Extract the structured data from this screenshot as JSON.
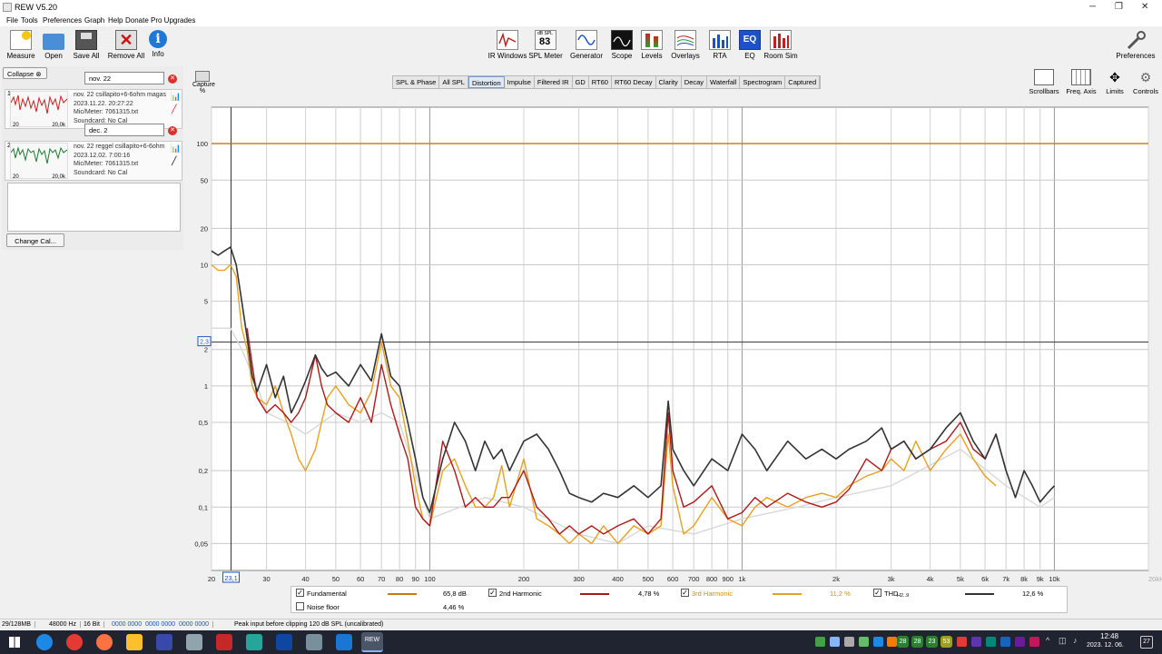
{
  "app": {
    "title": "REW V5.20"
  },
  "window_controls": {
    "minimize": "─",
    "maximize": "❐",
    "close": "✕"
  },
  "menu": [
    "File",
    "Tools",
    "Preferences",
    "Graph",
    "Help",
    "Donate",
    "Pro Upgrades"
  ],
  "toolbar_left": [
    {
      "label": "Measure",
      "icon": "microphone-icon"
    },
    {
      "label": "Open",
      "icon": "folder-icon"
    },
    {
      "label": "Save All",
      "icon": "save-icon"
    },
    {
      "label": "Remove All",
      "icon": "remove-icon"
    },
    {
      "label": "Info",
      "icon": "info-icon"
    }
  ],
  "toolbar_center": [
    {
      "label": "IR Windows",
      "icon": "ir-windows-icon"
    },
    {
      "label": "SPL Meter",
      "icon": "spl-meter-icon",
      "badge_top": "dB SPL",
      "badge_value": "83"
    },
    {
      "label": "Generator",
      "icon": "generator-icon"
    },
    {
      "label": "Scope",
      "icon": "scope-icon"
    },
    {
      "label": "Levels",
      "icon": "levels-icon"
    },
    {
      "label": "Overlays",
      "icon": "overlays-icon"
    },
    {
      "label": "RTA",
      "icon": "rta-icon"
    },
    {
      "label": "EQ",
      "icon": "eq-icon"
    },
    {
      "label": "Room Sim",
      "icon": "room-sim-icon"
    }
  ],
  "toolbar_right": {
    "label": "Preferences",
    "icon": "wrench-icon"
  },
  "capture": {
    "label": "Capture",
    "unit": "%"
  },
  "tabs": [
    "SPL & Phase",
    "All SPL",
    "Distortion",
    "Impulse",
    "Filtered IR",
    "GD",
    "RT60",
    "RT60 Decay",
    "Clarity",
    "Decay",
    "Waterfall",
    "Spectrogram",
    "Captured"
  ],
  "selected_tab": "Distortion",
  "graph_controls": [
    "Scrollbars",
    "Freq. Axis",
    "Limits",
    "Controls"
  ],
  "left_panel": {
    "collapse_label": "Collapse",
    "change_cal_label": "Change Cal...",
    "measurements": [
      {
        "index": "1",
        "name": "nov. 22",
        "title": "nov. 22 csillapito+6-6ohm magas",
        "date": "2023.11.22. 20:27:22",
        "mic": "Mic/Meter: 7061315.txt",
        "soundcard": "Soundcard: No Cal",
        "thumb_left": "20",
        "thumb_right": "20,0k",
        "color": "#c81e1e"
      },
      {
        "index": "2",
        "name": "dec. 2",
        "title": "nov. 22 reggel csillapito+6-6ohm",
        "date": "2023.12.02. 7:00:16",
        "mic": "Mic/Meter: 7061315.txt",
        "soundcard": "Soundcard: No Cal",
        "thumb_left": "20",
        "thumb_right": "20,0k",
        "color": "#1e7a2e"
      }
    ]
  },
  "chart_data": {
    "type": "line",
    "xscale": "log",
    "yscale": "log",
    "xlim": [
      20,
      20000
    ],
    "ylim": [
      0.03,
      200
    ],
    "y_ticks": [
      "100",
      "50",
      "20",
      "10",
      "5",
      "2",
      "1",
      "0,5",
      "0,2",
      "0,1",
      "0,05"
    ],
    "y_tick_values": [
      100,
      50,
      20,
      10,
      5,
      2,
      1,
      0.5,
      0.2,
      0.1,
      0.05
    ],
    "x_ticks": [
      "20",
      "30",
      "40",
      "50",
      "60",
      "70",
      "80",
      "90",
      "100",
      "200",
      "300",
      "400",
      "500",
      "600",
      "700",
      "800",
      "900",
      "1k",
      "2k",
      "3k",
      "4k",
      "5k",
      "6k",
      "7k",
      "8k",
      "9k",
      "10k",
      "20kHz"
    ],
    "x_tick_values": [
      20,
      30,
      40,
      50,
      60,
      70,
      80,
      90,
      100,
      200,
      300,
      400,
      500,
      600,
      700,
      800,
      900,
      1000,
      2000,
      3000,
      4000,
      5000,
      6000,
      7000,
      8000,
      9000,
      10000,
      20000
    ],
    "x_ticks_faded": [
      "10k",
      "20kHz"
    ],
    "cursor_x_label": "23,1",
    "cursor_x": 23.1,
    "cursor_y_label": "2,3",
    "cursor_y": 2.3,
    "hline_100": 100,
    "series": [
      {
        "name": "THD",
        "color": "#333333",
        "x": [
          20,
          21,
          22,
          23,
          24,
          25,
          26,
          27,
          28,
          30,
          32,
          34,
          36,
          38,
          40,
          43,
          45,
          47,
          50,
          55,
          60,
          65,
          70,
          75,
          80,
          85,
          90,
          95,
          100,
          110,
          120,
          130,
          140,
          150,
          160,
          170,
          180,
          200,
          220,
          240,
          260,
          280,
          300,
          330,
          360,
          400,
          450,
          500,
          550,
          580,
          600,
          650,
          700,
          800,
          900,
          1000,
          1100,
          1200,
          1400,
          1600,
          1800,
          2000,
          2200,
          2500,
          2800,
          3000,
          3300,
          3600,
          4000,
          4500,
          5000,
          5500,
          6000,
          6500,
          7000,
          7500,
          8000,
          8500,
          9000,
          9500,
          10000
        ],
        "y": [
          13,
          12,
          13,
          14,
          10,
          5,
          2.5,
          1.2,
          0.9,
          1.5,
          0.8,
          1.2,
          0.6,
          0.8,
          1.1,
          1.8,
          1.4,
          1.2,
          1.3,
          1.0,
          1.5,
          1.1,
          2.7,
          1.2,
          1.0,
          0.5,
          0.25,
          0.12,
          0.09,
          0.25,
          0.5,
          0.35,
          0.2,
          0.35,
          0.25,
          0.3,
          0.2,
          0.35,
          0.4,
          0.3,
          0.2,
          0.13,
          0.12,
          0.11,
          0.13,
          0.12,
          0.15,
          0.12,
          0.15,
          0.75,
          0.3,
          0.2,
          0.15,
          0.25,
          0.2,
          0.4,
          0.3,
          0.2,
          0.35,
          0.25,
          0.3,
          0.25,
          0.3,
          0.35,
          0.45,
          0.3,
          0.35,
          0.25,
          0.3,
          0.45,
          0.6,
          0.35,
          0.25,
          0.4,
          0.2,
          0.12,
          0.2,
          0.15,
          0.11,
          0.13,
          0.15
        ]
      },
      {
        "name": "Fundamental",
        "color": "#c87814",
        "x": [
          20,
          20000
        ],
        "y": [
          100,
          100
        ]
      },
      {
        "name": "2nd Harmonic",
        "color": "#b01818",
        "x": [
          26,
          27,
          28,
          30,
          32,
          34,
          36,
          38,
          40,
          43,
          45,
          47,
          50,
          55,
          60,
          65,
          70,
          75,
          80,
          85,
          90,
          95,
          100,
          110,
          120,
          130,
          140,
          150,
          160,
          170,
          180,
          200,
          220,
          240,
          260,
          280,
          300,
          330,
          360,
          400,
          450,
          500,
          550,
          580,
          600,
          650,
          700,
          800,
          900,
          1000,
          1100,
          1200,
          1400,
          1600,
          1800,
          2000,
          2200,
          2500,
          2800,
          3000,
          3300,
          3600,
          4000,
          4500,
          5000,
          5500,
          6000,
          6500,
          7000
        ],
        "y": [
          3,
          1.5,
          0.8,
          0.6,
          0.7,
          0.6,
          0.5,
          0.6,
          0.8,
          1.8,
          1.0,
          0.7,
          0.6,
          0.5,
          0.8,
          0.5,
          1.5,
          0.7,
          0.4,
          0.25,
          0.1,
          0.08,
          0.07,
          0.35,
          0.2,
          0.1,
          0.12,
          0.1,
          0.1,
          0.12,
          0.12,
          0.2,
          0.1,
          0.08,
          0.06,
          0.07,
          0.06,
          0.07,
          0.06,
          0.07,
          0.08,
          0.06,
          0.08,
          0.6,
          0.2,
          0.1,
          0.11,
          0.15,
          0.08,
          0.09,
          0.12,
          0.1,
          0.13,
          0.11,
          0.1,
          0.11,
          0.14,
          0.25,
          0.2,
          0.3,
          0.35,
          0.25,
          0.3,
          0.35,
          0.5,
          0.3,
          0.25,
          0.4,
          0.2
        ]
      },
      {
        "name": "3rd Harmonic",
        "color": "#e8a020",
        "x": [
          20,
          21,
          22,
          23,
          24,
          25,
          26,
          27,
          28,
          30,
          32,
          34,
          36,
          38,
          40,
          43,
          45,
          47,
          50,
          55,
          60,
          65,
          70,
          75,
          80,
          85,
          90,
          95,
          100,
          110,
          120,
          130,
          140,
          150,
          160,
          170,
          180,
          200,
          220,
          240,
          260,
          280,
          300,
          330,
          360,
          400,
          450,
          500,
          550,
          580,
          600,
          650,
          700,
          800,
          900,
          1000,
          1100,
          1200,
          1400,
          1600,
          1800,
          2000,
          2200,
          2500,
          2800,
          3000,
          3300,
          3600,
          4000,
          4500,
          5000,
          5500,
          6000,
          6500
        ],
        "y": [
          10,
          9,
          9,
          10,
          8,
          3,
          2,
          1,
          0.8,
          0.7,
          1.0,
          0.6,
          0.4,
          0.25,
          0.2,
          0.3,
          0.5,
          0.8,
          1.0,
          0.7,
          0.6,
          0.9,
          2.3,
          1.0,
          0.8,
          0.35,
          0.15,
          0.08,
          0.07,
          0.2,
          0.25,
          0.15,
          0.1,
          0.1,
          0.12,
          0.22,
          0.1,
          0.25,
          0.08,
          0.07,
          0.06,
          0.05,
          0.06,
          0.05,
          0.07,
          0.05,
          0.07,
          0.06,
          0.07,
          0.4,
          0.15,
          0.06,
          0.07,
          0.12,
          0.08,
          0.07,
          0.1,
          0.12,
          0.1,
          0.12,
          0.13,
          0.12,
          0.15,
          0.18,
          0.2,
          0.25,
          0.2,
          0.35,
          0.2,
          0.3,
          0.4,
          0.25,
          0.18,
          0.15
        ]
      },
      {
        "name": "Noise floor",
        "color": "#d8d8d8",
        "x": [
          20,
          23,
          25,
          28,
          30,
          35,
          40,
          50,
          60,
          70,
          80,
          100,
          150,
          200,
          300,
          400,
          500,
          700,
          1000,
          1500,
          2000,
          3000,
          5000,
          7000,
          9000,
          10000
        ],
        "y": [
          3,
          3,
          2,
          1,
          0.6,
          0.5,
          0.4,
          0.6,
          0.5,
          0.6,
          0.5,
          0.08,
          0.12,
          0.1,
          0.06,
          0.05,
          0.07,
          0.06,
          0.08,
          0.1,
          0.12,
          0.15,
          0.3,
          0.15,
          0.1,
          0.12
        ]
      }
    ]
  },
  "legend": [
    {
      "label": "Fundamental",
      "value": "65,8 dB",
      "checked": true,
      "color": "#c87814"
    },
    {
      "label": "2nd Harmonic",
      "value": "4,78 %",
      "checked": true,
      "color": "#b01818"
    },
    {
      "label": "3rd Harmonic",
      "value": "11,2 %",
      "checked": true,
      "color": "#e8a020"
    },
    {
      "label": "THD",
      "sub": "H2..9",
      "value": "12,6 %",
      "checked": true,
      "color": "#333333"
    },
    {
      "label": "Noise floor",
      "value": "4,46 %",
      "checked": false,
      "color": "#bbbbbb"
    }
  ],
  "status": {
    "memory": "29/128MB",
    "rate": "48000 Hz",
    "bits": "16 Bit",
    "levels": "0000 0000  0000 0000  0000 0000",
    "message": "Peak input before clipping 120 dB SPL (uncalibrated)"
  },
  "taskbar": {
    "time": "12:48",
    "date": "2023. 12. 06.",
    "notifications": "27",
    "tray_numbers": [
      "28",
      "28",
      "23",
      "53"
    ],
    "rew_label": "REW"
  }
}
